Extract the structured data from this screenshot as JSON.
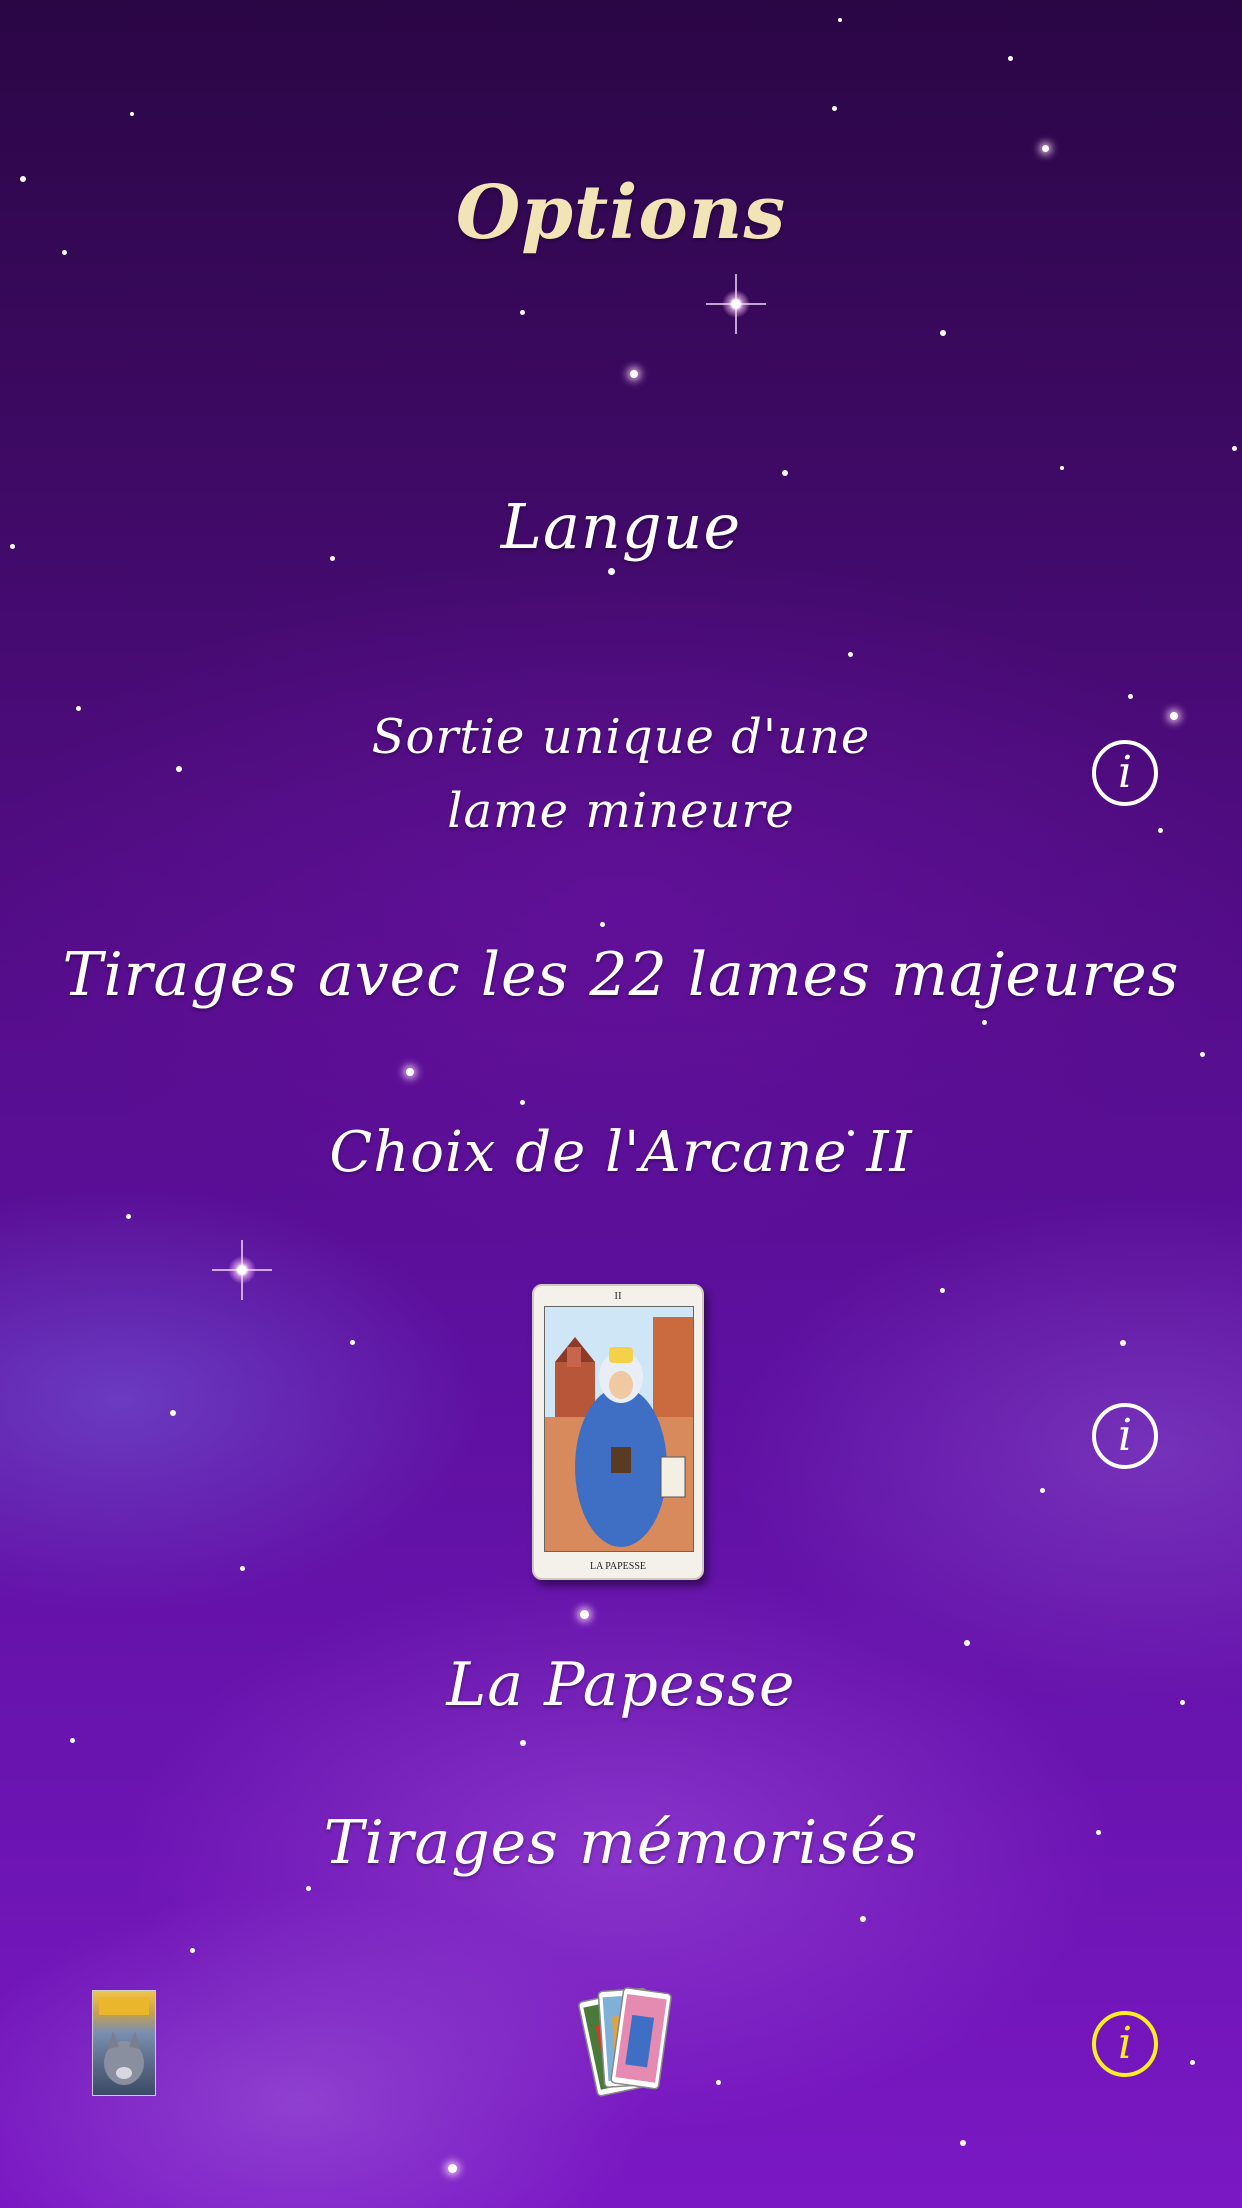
{
  "screen": {
    "title": "Options",
    "background_color": "#5a0f96",
    "title_color": "#f3e4b8"
  },
  "options": {
    "language_label": "Langue",
    "single_minor_line1": "Sortie unique d'une",
    "single_minor_line2": "lame mineure",
    "major_arcana_draws_label": "Tirages avec les 22 lames majeures",
    "arcana_choice_label": "Choix de l'Arcane II",
    "selected_card": {
      "numeral": "II",
      "caption": "LA PAPESSE",
      "name": "La Papesse"
    },
    "saved_draws_label": "Tirages mémorisés"
  },
  "icons": {
    "info_glyph": "i",
    "info_icon_1": "info-icon",
    "info_icon_2": "info-icon",
    "info_icon_3": "info-icon",
    "info_icon_3_color": "#ffee22",
    "left_thumbnail": "wolf-card-thumbnail",
    "center_icon": "tarot-deck-icon"
  }
}
